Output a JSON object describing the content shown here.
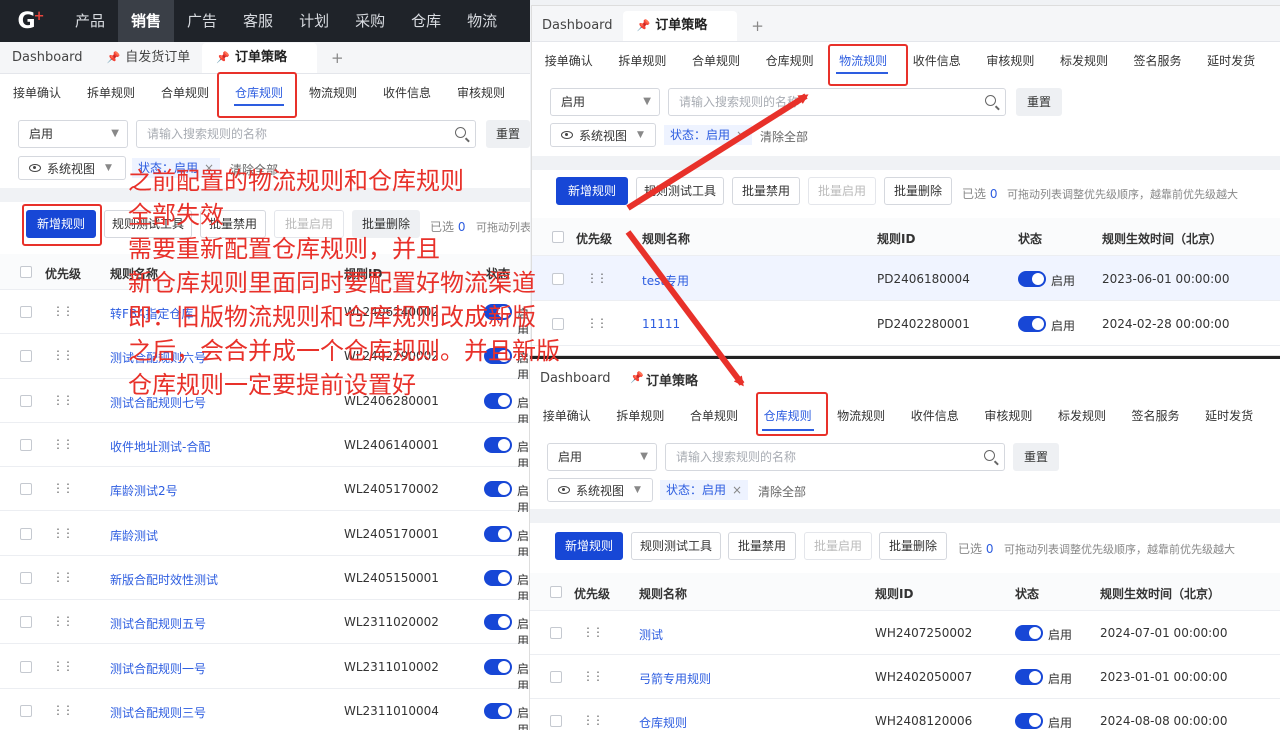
{
  "topnav": {
    "logo": "G",
    "items": [
      "产品",
      "销售",
      "广告",
      "客服",
      "计划",
      "采购",
      "仓库",
      "物流"
    ],
    "active": "销售"
  },
  "left": {
    "tabs": {
      "dashboard": "Dashboard",
      "t1": "自发货订单",
      "t2": "订单策略",
      "plus": "+"
    },
    "subtabs": [
      "接单确认",
      "拆单规则",
      "合单规则",
      "仓库规则",
      "物流规则",
      "收件信息",
      "审核规则"
    ],
    "filter": {
      "status": "启用",
      "placeholder": "请输入搜索规则的名称",
      "reset": "重置",
      "view": "系统视图",
      "chip_label": "状态：启用",
      "clear": "清除全部"
    },
    "toolbar": {
      "add": "新增规则",
      "test": "规则测试工具",
      "disable": "批量禁用",
      "enable": "批量启用",
      "delete": "批量删除",
      "selected_prefix": "已选",
      "selected_count": "0",
      "hint": "可拖动列表"
    },
    "headers": {
      "priority": "优先级",
      "name": "规则名称",
      "id": "规则ID",
      "status": "状态"
    },
    "status_text": "启用",
    "rows": [
      {
        "name": "转FBA指定仓库",
        "id": "WL2406240002"
      },
      {
        "name": "测试合配规则六号",
        "id": "WL2402290002"
      },
      {
        "name": "测试合配规则七号",
        "id": "WL2406280001"
      },
      {
        "name": "收件地址测试-合配",
        "id": "WL2406140001"
      },
      {
        "name": "库龄测试2号",
        "id": "WL2405170002"
      },
      {
        "name": "库龄测试",
        "id": "WL2405170001"
      },
      {
        "name": "新版合配时效性测试",
        "id": "WL2405150001"
      },
      {
        "name": "测试合配规则五号",
        "id": "WL2311020002"
      },
      {
        "name": "测试合配规则一号",
        "id": "WL2311010002"
      },
      {
        "name": "测试合配规则三号",
        "id": "WL2311010004"
      }
    ]
  },
  "topright": {
    "tabs": {
      "dashboard": "Dashboard",
      "t1": "订单策略",
      "plus": "+"
    },
    "subtabs": [
      "接单确认",
      "拆单规则",
      "合单规则",
      "仓库规则",
      "物流规则",
      "收件信息",
      "审核规则",
      "标发规则",
      "签名服务",
      "延时发货"
    ],
    "filter": {
      "status": "启用",
      "placeholder": "请输入搜索规则的名称",
      "reset": "重置",
      "view": "系统视图",
      "chip_label": "状态：启用",
      "clear": "清除全部"
    },
    "toolbar": {
      "add": "新增规则",
      "test": "规则测试工具",
      "disable": "批量禁用",
      "enable": "批量启用",
      "delete": "批量删除",
      "selected_prefix": "已选",
      "selected_count": "0",
      "hint": "可拖动列表调整优先级顺序，越靠前优先级越大"
    },
    "headers": {
      "priority": "优先级",
      "name": "规则名称",
      "id": "规则ID",
      "status": "状态",
      "time": "规则生效时间（北京）"
    },
    "status_text": "启用",
    "rows": [
      {
        "name": "test专用",
        "id": "PD2406180004",
        "time": "2023-06-01 00:00:00"
      },
      {
        "name": "11111",
        "id": "PD2402280001",
        "time": "2024-02-28 00:00:00"
      }
    ]
  },
  "bottomright": {
    "tabs": {
      "dashboard": "Dashboard",
      "t1": "订单策略"
    },
    "subtabs": [
      "接单确认",
      "拆单规则",
      "合单规则",
      "仓库规则",
      "物流规则",
      "收件信息",
      "审核规则",
      "标发规则",
      "签名服务",
      "延时发货"
    ],
    "filter": {
      "status": "启用",
      "placeholder": "请输入搜索规则的名称",
      "reset": "重置",
      "view": "系统视图",
      "chip_label": "状态：启用",
      "clear": "清除全部"
    },
    "toolbar": {
      "add": "新增规则",
      "test": "规则测试工具",
      "disable": "批量禁用",
      "enable": "批量启用",
      "delete": "批量删除",
      "selected_prefix": "已选",
      "selected_count": "0",
      "hint": "可拖动列表调整优先级顺序，越靠前优先级越大"
    },
    "headers": {
      "priority": "优先级",
      "name": "规则名称",
      "id": "规则ID",
      "status": "状态",
      "time": "规则生效时间（北京）"
    },
    "status_text": "启用",
    "rows": [
      {
        "name": "测试",
        "id": "WH2407250002",
        "time": "2024-07-01 00:00:00"
      },
      {
        "name": "弓箭专用规则",
        "id": "WH2402050007",
        "time": "2023-01-01 00:00:00"
      },
      {
        "name": "仓库规则",
        "id": "WH2408120006",
        "time": "2024-08-08 00:00:00"
      }
    ]
  },
  "annotation": {
    "lines": [
      "之前配置的物流规则和仓库规则",
      "全部失效",
      "需要重新配置仓库规则，并且",
      "新仓库规则里面同时要配置好物流渠道",
      "即：旧版物流规则和仓库规则改成新版",
      "之后，会合并成一个仓库规则。并且新版",
      "仓库规则一定要提前设置好"
    ],
    "color": "#e8312a"
  }
}
